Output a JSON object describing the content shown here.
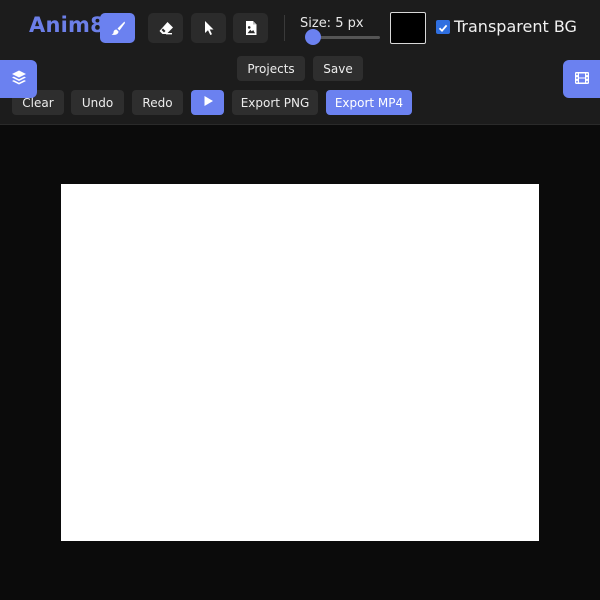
{
  "app": {
    "logo": "Anim8"
  },
  "tools": [
    {
      "name": "brush",
      "icon": "brush-icon",
      "active": true
    },
    {
      "name": "eraser",
      "icon": "eraser-icon",
      "active": false
    },
    {
      "name": "select",
      "icon": "cursor-icon",
      "active": false
    },
    {
      "name": "image",
      "icon": "image-file-icon",
      "active": false
    }
  ],
  "brush_size": {
    "label": "Size: 5 px",
    "value": 5
  },
  "color": {
    "current": "#000000"
  },
  "transparent_bg": {
    "label": "Transparent BG",
    "checked": true
  },
  "side_buttons": {
    "left_icon": "layers-icon",
    "right_icon": "film-icon"
  },
  "actions": {
    "projects": "Projects",
    "save": "Save",
    "clear": "Clear",
    "undo": "Undo",
    "redo": "Redo",
    "play_icon": "play-icon",
    "export_png": "Export PNG",
    "export_mp4": "Export MP4"
  },
  "colors": {
    "accent": "#6b81f0",
    "logo": "#6c7fe8",
    "header_bg": "#1c1c1c",
    "button_bg": "#2e2e2e",
    "page_bg": "#0b0b0b",
    "canvas_bg": "#ffffff"
  }
}
